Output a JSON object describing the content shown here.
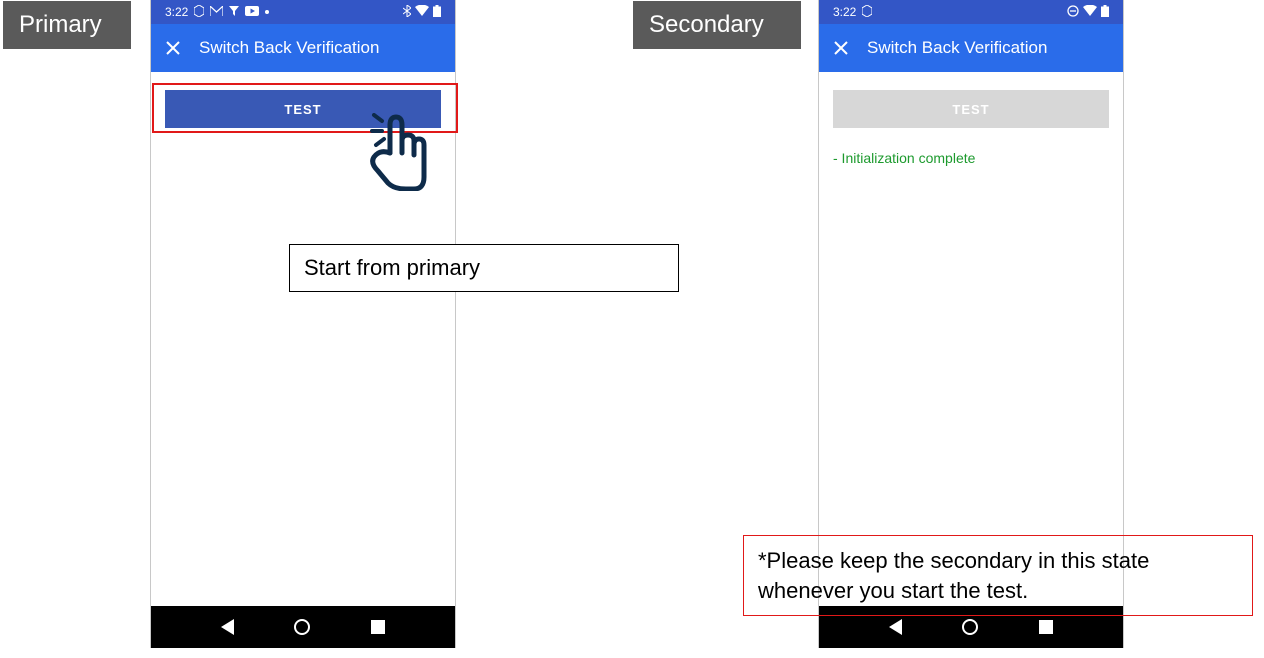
{
  "labels": {
    "primary": "Primary",
    "secondary": "Secondary"
  },
  "phones": {
    "primary": {
      "status_time": "3:22",
      "title": "Switch Back Verification",
      "test_button": "TEST"
    },
    "secondary": {
      "status_time": "3:22",
      "title": "Switch Back Verification",
      "test_button": "TEST",
      "status_msg": "- Initialization complete"
    }
  },
  "annotations": {
    "start": "Start from primary",
    "keep": "*Please keep the secondary in this state whenever you start the test."
  }
}
